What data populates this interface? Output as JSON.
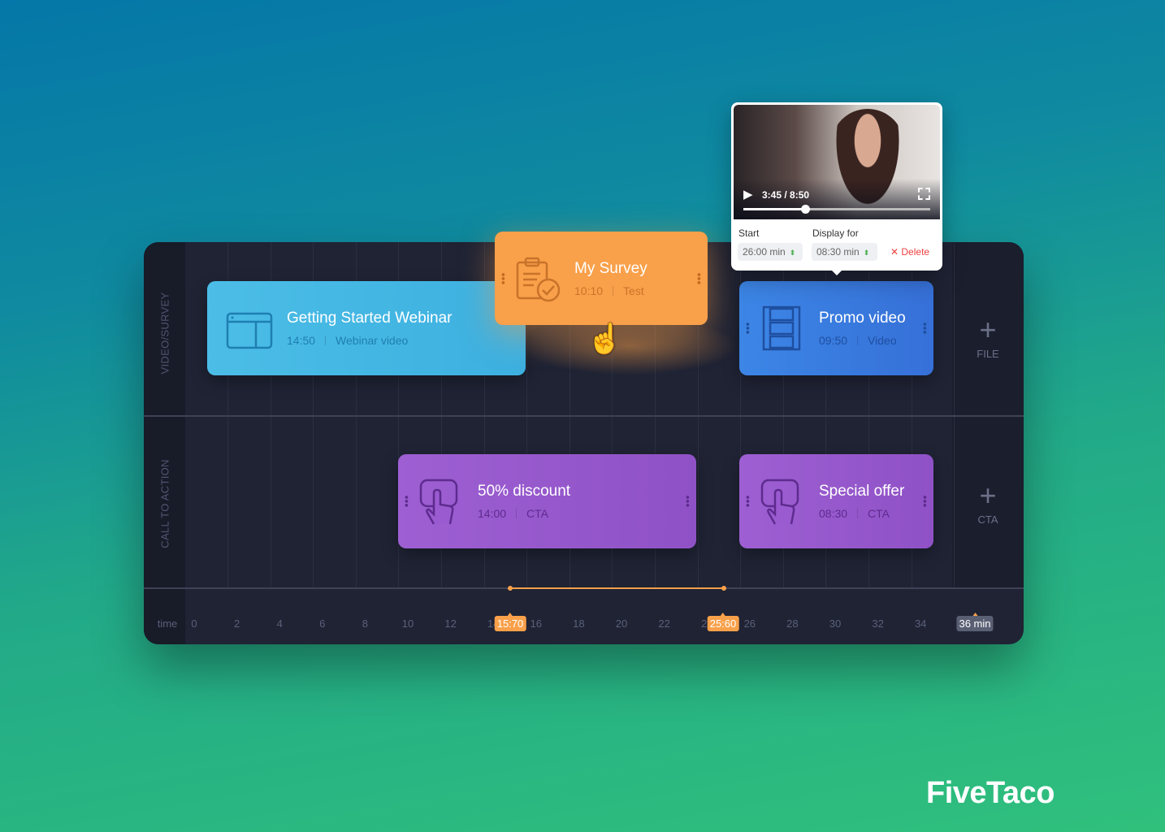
{
  "rows": [
    {
      "label": "VIDEO/SURVEY"
    },
    {
      "label": "CALL TO ACTION"
    }
  ],
  "cards": {
    "webinar": {
      "title": "Getting Started Webinar",
      "time": "14:50",
      "type": "Webinar video",
      "color": "#45b8e4",
      "icon": "browser-window-icon"
    },
    "survey": {
      "title": "My Survey",
      "time": "10:10",
      "type": "Test",
      "color": "#f9a04a",
      "icon": "clipboard-check-icon"
    },
    "promo": {
      "title": "Promo video",
      "time": "09:50",
      "type": "Video",
      "color": "#3a7be0",
      "icon": "film-strip-icon"
    },
    "discount": {
      "title": "50% discount",
      "time": "14:00",
      "type": "CTA",
      "color": "#9b5bd0",
      "icon": "hand-tap-icon"
    },
    "special": {
      "title": "Special offer",
      "time": "08:30",
      "type": "CTA",
      "color": "#9b5bd0",
      "icon": "hand-tap-icon"
    }
  },
  "add_buttons": {
    "file": "FILE",
    "cta": "CTA"
  },
  "timeline": {
    "label": "time",
    "ticks": [
      "0",
      "2",
      "4",
      "6",
      "8",
      "10",
      "12",
      "14",
      "16",
      "18",
      "20",
      "22",
      "24",
      "26",
      "28",
      "30",
      "32",
      "34"
    ],
    "marker_start": "15:70",
    "marker_end": "25:60",
    "total": "36 min",
    "accent": "#f9a04a"
  },
  "popup": {
    "video_time": "3:45 / 8:50",
    "progress": 0.33,
    "start_label": "Start",
    "start_value": "26:00 min",
    "display_label": "Display for",
    "display_value": "08:30 min",
    "delete_label": "Delete"
  },
  "brand": "FiveTaco"
}
